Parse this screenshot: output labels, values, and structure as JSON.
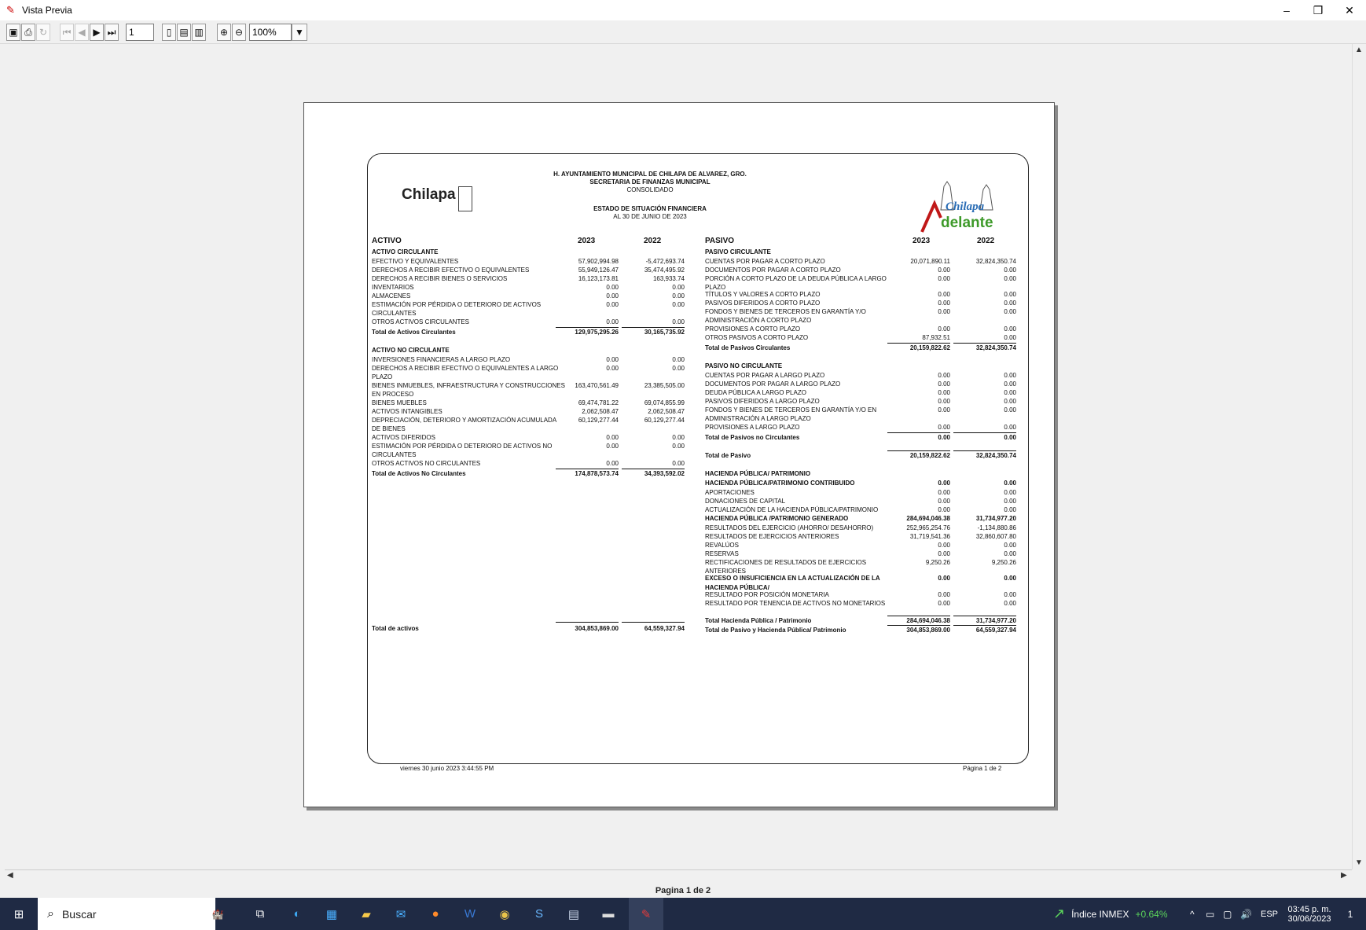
{
  "window": {
    "title": "Vista Previa",
    "minimize": "–",
    "maximize": "❐",
    "close": "✕"
  },
  "toolbar": {
    "page_input": "1",
    "zoom": "100%"
  },
  "report": {
    "org": "H. AYUNTAMIENTO MUNICIPAL DE CHILAPA DE ALVAREZ, GRO.",
    "dept": "SECRETARIA DE FINANZAS MUNICIPAL",
    "scope": "CONSOLIDADO",
    "title": "ESTADO DE SITUACIÓN FINANCIERA",
    "date": "AL 30 DE JUNIO DE 2023",
    "logo_left": "Chilapa",
    "logo_right_top": "Chilapa",
    "logo_right_bottom": "delante",
    "activo_header": "ACTIVO",
    "pasivo_header": "PASIVO",
    "y1": "2023",
    "y2": "2022",
    "footer_date": "viernes 30 junio 2023 3:44:55 PM",
    "footer_page": "Página 1 de 2",
    "left_rows": [
      {
        "l": "ACTIVO  CIRCULANTE",
        "a": "",
        "b": "",
        "s": "b"
      },
      {
        "l": "EFECTIVO Y EQUIVALENTES",
        "a": "57,902,994.98",
        "b": "-5,472,693.74",
        "s": ""
      },
      {
        "l": "DERECHOS A RECIBIR EFECTIVO O EQUIVALENTES",
        "a": "55,949,126.47",
        "b": "35,474,495.92",
        "s": ""
      },
      {
        "l": "DERECHOS A RECIBIR BIENES O SERVICIOS",
        "a": "16,123,173.81",
        "b": "163,933.74",
        "s": ""
      },
      {
        "l": "INVENTARIOS",
        "a": "0.00",
        "b": "0.00",
        "s": ""
      },
      {
        "l": "ALMACENES",
        "a": "0.00",
        "b": "0.00",
        "s": ""
      },
      {
        "l": "ESTIMACIÓN POR PÉRDIDA O DETERIORO DE ACTIVOS",
        "a": "0.00",
        "b": "0.00",
        "s": ""
      },
      {
        "l": "CIRCULANTES",
        "a": "",
        "b": "",
        "s": ""
      },
      {
        "l": "OTROS ACTIVOS CIRCULANTES",
        "a": "0.00",
        "b": "0.00",
        "s": "u"
      },
      {
        "l": "Total de Activos Circulantes",
        "a": "129,975,295.26",
        "b": "30,165,735.92",
        "s": "b"
      },
      {
        "l": "",
        "a": "",
        "b": "",
        "s": ""
      },
      {
        "l": "ACTIVO NO CIRCULANTE",
        "a": "",
        "b": "",
        "s": "b"
      },
      {
        "l": "INVERSIONES FINANCIERAS A LARGO PLAZO",
        "a": "0.00",
        "b": "0.00",
        "s": ""
      },
      {
        "l": "DERECHOS A RECIBIR EFECTIVO O EQUIVALENTES A LARGO",
        "a": "0.00",
        "b": "0.00",
        "s": ""
      },
      {
        "l": "PLAZO",
        "a": "",
        "b": "",
        "s": ""
      },
      {
        "l": "BIENES INMUEBLES, INFRAESTRUCTURA Y CONSTRUCCIONES",
        "a": "163,470,561.49",
        "b": "23,385,505.00",
        "s": ""
      },
      {
        "l": "EN PROCESO",
        "a": "",
        "b": "",
        "s": ""
      },
      {
        "l": "BIENES MUEBLES",
        "a": "69,474,781.22",
        "b": "69,074,855.99",
        "s": ""
      },
      {
        "l": "ACTIVOS INTANGIBLES",
        "a": "2,062,508.47",
        "b": "2,062,508.47",
        "s": ""
      },
      {
        "l": "DEPRECIACIÓN, DETERIORO Y AMORTIZACIÓN ACUMULADA",
        "a": "60,129,277.44",
        "b": "60,129,277.44",
        "s": ""
      },
      {
        "l": "DE BIENES",
        "a": "",
        "b": "",
        "s": ""
      },
      {
        "l": "ACTIVOS DIFERIDOS",
        "a": "0.00",
        "b": "0.00",
        "s": ""
      },
      {
        "l": "ESTIMACIÓN POR PÉRDIDA O DETERIORO DE ACTIVOS NO",
        "a": "0.00",
        "b": "0.00",
        "s": ""
      },
      {
        "l": "CIRCULANTES",
        "a": "",
        "b": "",
        "s": ""
      },
      {
        "l": "OTROS ACTIVOS NO CIRCULANTES",
        "a": "0.00",
        "b": "0.00",
        "s": "u"
      },
      {
        "l": "Total de Activos No Circulantes",
        "a": "174,878,573.74",
        "b": "34,393,592.02",
        "s": "b"
      }
    ],
    "total_activos": {
      "l": "Total de activos",
      "a": "304,853,869.00",
      "b": "64,559,327.94"
    },
    "right_rows": [
      {
        "l": "PASIVO  CIRCULANTE",
        "a": "",
        "b": "",
        "s": "b"
      },
      {
        "l": "CUENTAS POR PAGAR A CORTO PLAZO",
        "a": "20,071,890.11",
        "b": "32,824,350.74",
        "s": ""
      },
      {
        "l": "DOCUMENTOS POR PAGAR A CORTO PLAZO",
        "a": "0.00",
        "b": "0.00",
        "s": ""
      },
      {
        "l": "PORCIÓN A CORTO PLAZO DE LA DEUDA PÚBLICA A LARGO",
        "a": "0.00",
        "b": "0.00",
        "s": ""
      },
      {
        "l": "PLAZO",
        "a": "",
        "b": "",
        "s": "t"
      },
      {
        "l": "TÍTULOS Y VALORES A CORTO PLAZO",
        "a": "0.00",
        "b": "0.00",
        "s": ""
      },
      {
        "l": "PASIVOS DIFERIDOS A CORTO PLAZO",
        "a": "0.00",
        "b": "0.00",
        "s": ""
      },
      {
        "l": "FONDOS Y BIENES DE TERCEROS EN GARANTÍA Y/O",
        "a": "0.00",
        "b": "0.00",
        "s": ""
      },
      {
        "l": "ADMINISTRACIÓN A CORTO PLAZO",
        "a": "",
        "b": "",
        "s": ""
      },
      {
        "l": "PROVISIONES A CORTO PLAZO",
        "a": "0.00",
        "b": "0.00",
        "s": ""
      },
      {
        "l": "OTROS PASIVOS A CORTO PLAZO",
        "a": "87,932.51",
        "b": "0.00",
        "s": "u"
      },
      {
        "l": "Total de Pasivos Circulantes",
        "a": "20,159,822.62",
        "b": "32,824,350.74",
        "s": "b"
      },
      {
        "l": "",
        "a": "",
        "b": "",
        "s": ""
      },
      {
        "l": "PASIVO NO CIRCULANTE",
        "a": "",
        "b": "",
        "s": "b"
      },
      {
        "l": "CUENTAS POR PAGAR A LARGO PLAZO",
        "a": "0.00",
        "b": "0.00",
        "s": ""
      },
      {
        "l": "DOCUMENTOS POR PAGAR A LARGO PLAZO",
        "a": "0.00",
        "b": "0.00",
        "s": ""
      },
      {
        "l": "DEUDA PÚBLICA A LARGO PLAZO",
        "a": "0.00",
        "b": "0.00",
        "s": ""
      },
      {
        "l": "PASIVOS DIFERIDOS A LARGO PLAZO",
        "a": "0.00",
        "b": "0.00",
        "s": ""
      },
      {
        "l": "FONDOS Y BIENES DE TERCEROS EN GARANTÍA Y/O EN",
        "a": "0.00",
        "b": "0.00",
        "s": ""
      },
      {
        "l": "ADMINISTRACIÓN A LARGO PLAZO",
        "a": "",
        "b": "",
        "s": ""
      },
      {
        "l": "PROVISIONES A LARGO PLAZO",
        "a": "0.00",
        "b": "0.00",
        "s": "u"
      },
      {
        "l": "Total de Pasivos no Circulantes",
        "a": "0.00",
        "b": "0.00",
        "s": "b"
      },
      {
        "l": "",
        "a": "",
        "b": "",
        "s": ""
      },
      {
        "l": "Total de Pasivo",
        "a": "20,159,822.62",
        "b": "32,824,350.74",
        "s": "bo"
      },
      {
        "l": "",
        "a": "",
        "b": "",
        "s": ""
      },
      {
        "l": "HACIENDA PÚBLICA/ PATRIMONIO",
        "a": "",
        "b": "",
        "s": "b"
      },
      {
        "l": "HACIENDA PÚBLICA/PATRIMONIO CONTRIBUIDO",
        "a": "0.00",
        "b": "0.00",
        "s": "b"
      },
      {
        "l": "APORTACIONES",
        "a": "0.00",
        "b": "0.00",
        "s": ""
      },
      {
        "l": "DONACIONES DE CAPITAL",
        "a": "0.00",
        "b": "0.00",
        "s": ""
      },
      {
        "l": "ACTUALIZACIÓN DE LA HACIENDA PÚBLICA/PATRIMONIO",
        "a": "0.00",
        "b": "0.00",
        "s": ""
      },
      {
        "l": "HACIENDA PÚBLICA /PATRIMONIO GENERADO",
        "a": "284,694,046.38",
        "b": "31,734,977.20",
        "s": "b"
      },
      {
        "l": "RESULTADOS DEL EJERCICIO (AHORRO/ DESAHORRO)",
        "a": "252,965,254.76",
        "b": "-1,134,880.86",
        "s": ""
      },
      {
        "l": "RESULTADOS DE EJERCICIOS ANTERIORES",
        "a": "31,719,541.36",
        "b": "32,860,607.80",
        "s": ""
      },
      {
        "l": "REVALÚOS",
        "a": "0.00",
        "b": "0.00",
        "s": ""
      },
      {
        "l": "RESERVAS",
        "a": "0.00",
        "b": "0.00",
        "s": ""
      },
      {
        "l": "RECTIFICACIONES DE RESULTADOS DE EJERCICIOS",
        "a": "9,250.26",
        "b": "9,250.26",
        "s": ""
      },
      {
        "l": "ANTERIORES",
        "a": "",
        "b": "",
        "s": "t"
      },
      {
        "l": "EXCESO O INSUFICIENCIA EN LA ACTUALIZACIÓN DE LA",
        "a": "0.00",
        "b": "0.00",
        "s": "b"
      },
      {
        "l": "HACIENDA PÚBLICA/",
        "a": "",
        "b": "",
        "s": "bt"
      },
      {
        "l": "RESULTADO POR POSICIÓN MONETARIA",
        "a": "0.00",
        "b": "0.00",
        "s": ""
      },
      {
        "l": "RESULTADO POR TENENCIA DE ACTIVOS NO MONETARIOS",
        "a": "0.00",
        "b": "0.00",
        "s": ""
      },
      {
        "l": "",
        "a": "",
        "b": "",
        "s": ""
      },
      {
        "l": "Total Hacienda Pública / Patrimonio",
        "a": "284,694,046.38",
        "b": "31,734,977.20",
        "s": "bo"
      },
      {
        "l": "Total de Pasivo y Hacienda Pública/ Patrimonio",
        "a": "304,853,869.00",
        "b": "64,559,327.94",
        "s": "bo"
      }
    ]
  },
  "statusbar": {
    "page": "Pagina 1 de 2"
  },
  "taskbar": {
    "search_label": "Buscar",
    "inmex_label": "Índice INMEX",
    "inmex_value": "+0.64%",
    "lang": "ESP",
    "time": "03:45 p. m.",
    "date": "30/06/2023",
    "notif": "1"
  }
}
